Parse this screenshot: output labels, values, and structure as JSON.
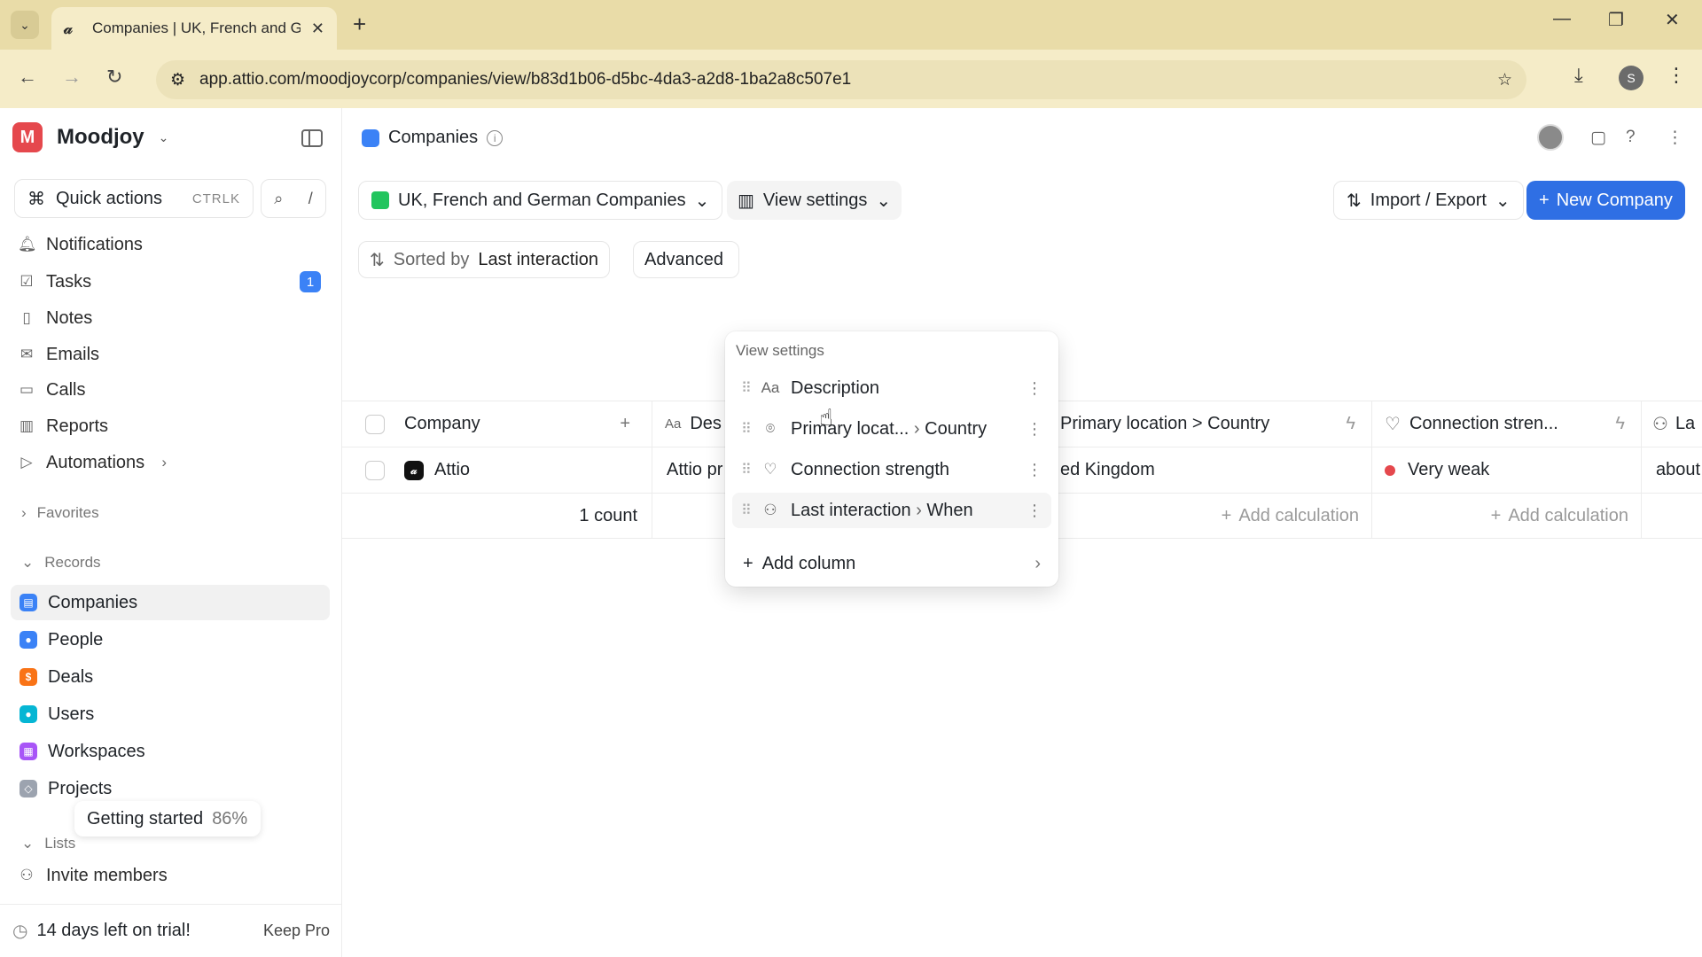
{
  "browser": {
    "tab_title": "Companies | UK, French and Ge",
    "url": "app.attio.com/moodjoycorp/companies/view/b83d1b06-d5bc-4da3-a2d8-1ba2a8c507e1",
    "profile_initial": "S"
  },
  "workspace": {
    "initial": "M",
    "name": "Moodjoy"
  },
  "quick_actions": {
    "label": "Quick actions",
    "shortcut": "CTRLK",
    "slash": "/"
  },
  "nav": [
    {
      "label": "Notifications"
    },
    {
      "label": "Tasks",
      "count": "1"
    },
    {
      "label": "Notes"
    },
    {
      "label": "Emails"
    },
    {
      "label": "Calls"
    },
    {
      "label": "Reports"
    },
    {
      "label": "Automations"
    }
  ],
  "sections": {
    "favorites": "Favorites",
    "records": "Records",
    "lists": "Lists"
  },
  "records": [
    {
      "label": "Companies",
      "color": "#3b82f6"
    },
    {
      "label": "People",
      "color": "#3b82f6"
    },
    {
      "label": "Deals",
      "color": "#f97316"
    },
    {
      "label": "Users",
      "color": "#06b6d4"
    },
    {
      "label": "Workspaces",
      "color": "#a855f7"
    },
    {
      "label": "Projects",
      "color": "#9ca3af"
    }
  ],
  "getting_started": {
    "label": "Getting started",
    "percent": "86%"
  },
  "invite": "Invite members",
  "trial": {
    "text": "14 days left on trial!",
    "action": "Keep Pro"
  },
  "header": {
    "title": "Companies"
  },
  "view": {
    "name": "UK, French and German Companies",
    "settings_label": "View settings"
  },
  "import_export": "Import / Export",
  "new_company": "New Company",
  "sort": {
    "prefix": "Sorted by",
    "field": "Last interaction"
  },
  "advanced": "Advanced",
  "table": {
    "headers": [
      "Company",
      "Des",
      "Primary location > Country",
      "Connection stren...",
      "La"
    ],
    "rows": [
      {
        "company": "Attio",
        "description": "Attio pr",
        "country": "ed Kingdom",
        "connection": "Very weak",
        "last": "about"
      }
    ],
    "footer": {
      "count": "1 count",
      "calc1": "Add calculation",
      "calc2": "Add calculation"
    }
  },
  "dropdown": {
    "title": "View settings",
    "items": [
      {
        "label": "Description",
        "icon": "text-icon"
      },
      {
        "label": "Primary locat...",
        "suffix": "Country",
        "icon": "location-pin-icon"
      },
      {
        "label": "Connection strength",
        "icon": "heart-icon"
      },
      {
        "label": "Last interaction",
        "suffix": "When",
        "icon": "people-icon"
      }
    ],
    "add_column": "Add column"
  }
}
